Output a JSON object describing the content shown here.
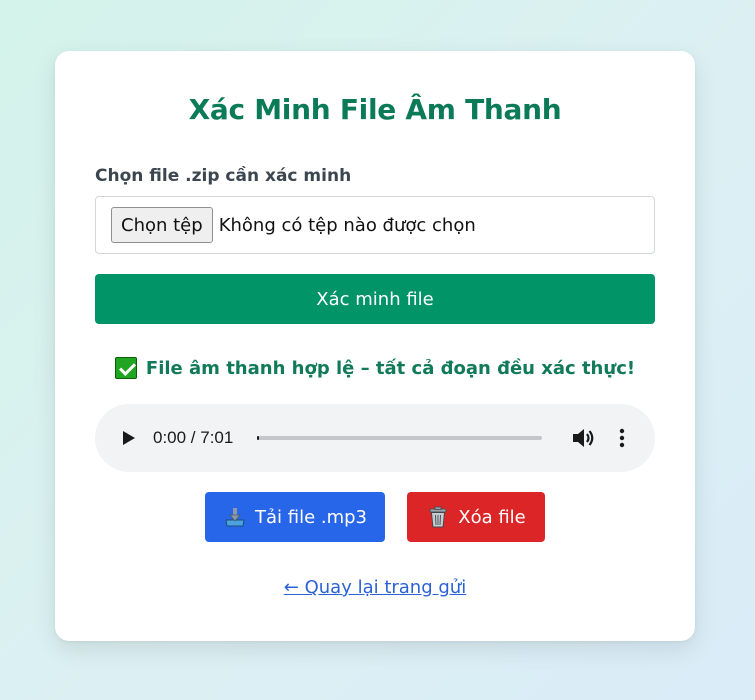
{
  "page": {
    "title": "Xác Minh File Âm Thanh"
  },
  "upload": {
    "label": "Chọn file .zip cần xác minh",
    "choose_button": "Chọn tệp",
    "no_file_text": "Không có tệp nào được chọn"
  },
  "verify_button": "Xác minh file",
  "result": {
    "icon": "check-mark-icon",
    "message": "File âm thanh hợp lệ – tất cả đoạn đều xác thực!"
  },
  "audio_player": {
    "time_display": "0:00 / 7:01",
    "progress_fraction": 0.0
  },
  "actions": {
    "download_label": "Tải file .mp3",
    "download_icon": "download-tray-icon",
    "delete_label": "Xóa file",
    "delete_icon": "trash-can-icon"
  },
  "back_link": "← Quay lại trang gửi",
  "colors": {
    "title": "#0b7a56",
    "verify_button": "#009467",
    "result_text": "#117a58",
    "download_button": "#2766e8",
    "delete_button": "#dc2527",
    "link": "#2a62d6"
  }
}
